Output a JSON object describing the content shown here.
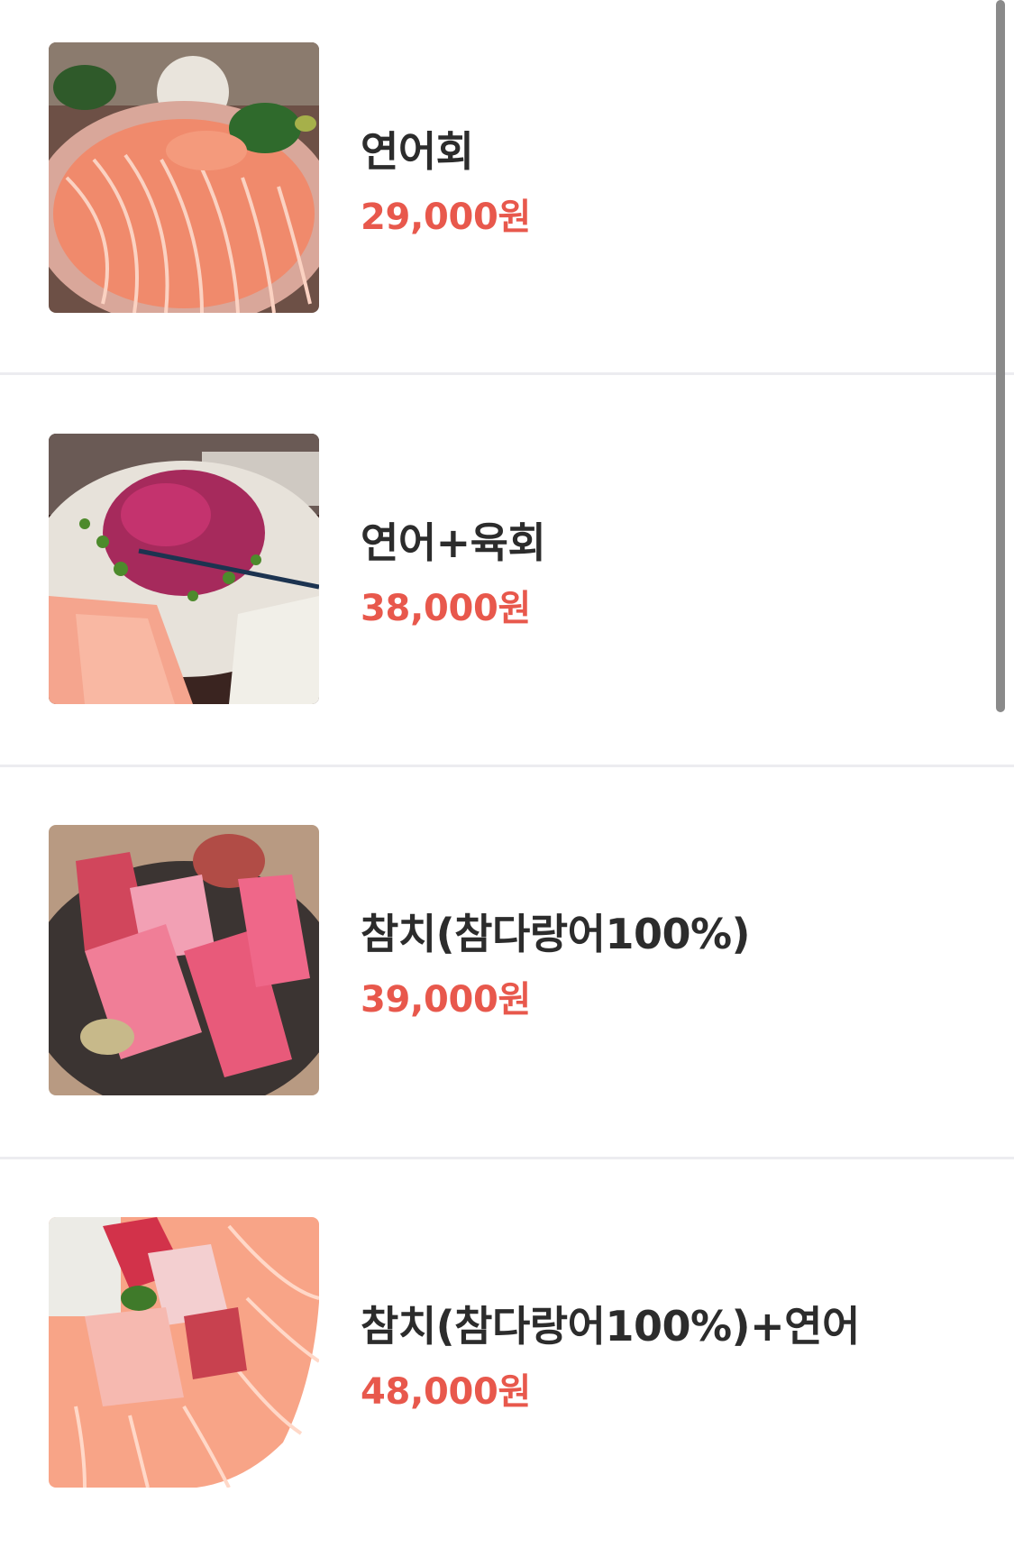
{
  "menu": {
    "items": [
      {
        "name": "연어회",
        "price": "29,000원",
        "image": "salmon-sashimi-photo"
      },
      {
        "name": "연어+육회",
        "price": "38,000원",
        "image": "salmon-yukhoe-photo"
      },
      {
        "name": "참치(참다랑어100%)",
        "price": "39,000원",
        "image": "tuna-sashimi-photo"
      },
      {
        "name": "참치(참다랑어100%)+연어",
        "price": "48,000원",
        "image": "tuna-salmon-platter-photo"
      }
    ]
  },
  "colors": {
    "background": "#ffffff",
    "name_text": "#2c2c2c",
    "price_text": "#e8584c",
    "divider": "#ececf0",
    "scrollbar": "#8a8a8a"
  }
}
